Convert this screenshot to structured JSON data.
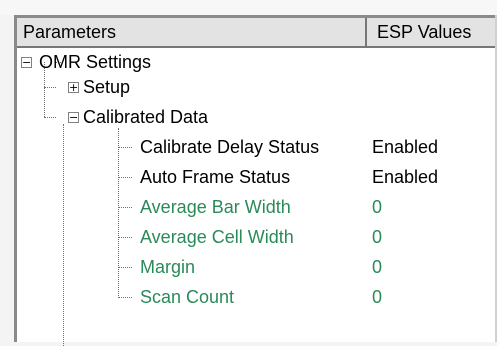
{
  "header": {
    "params_label": "Parameters",
    "values_label": "ESP Values"
  },
  "tree": {
    "root": {
      "label": "OMR Settings",
      "expanded": true
    },
    "setup": {
      "label": "Setup",
      "expanded": false
    },
    "calibrated": {
      "label": "Calibrated Data",
      "expanded": true
    },
    "items": [
      {
        "name": "Calibrate Delay Status",
        "value": "Enabled",
        "color": "#000000"
      },
      {
        "name": "Auto Frame Status",
        "value": "Enabled",
        "color": "#000000"
      },
      {
        "name": "Average Bar Width",
        "value": "0",
        "color": "#2a8a58"
      },
      {
        "name": "Average Cell Width",
        "value": "0",
        "color": "#2a8a58"
      },
      {
        "name": "Margin",
        "value": "0",
        "color": "#2a8a58"
      },
      {
        "name": "Scan Count",
        "value": "0",
        "color": "#2a8a58"
      }
    ]
  },
  "icons": {
    "collapse": "minus-box-icon",
    "expand": "plus-box-icon"
  }
}
